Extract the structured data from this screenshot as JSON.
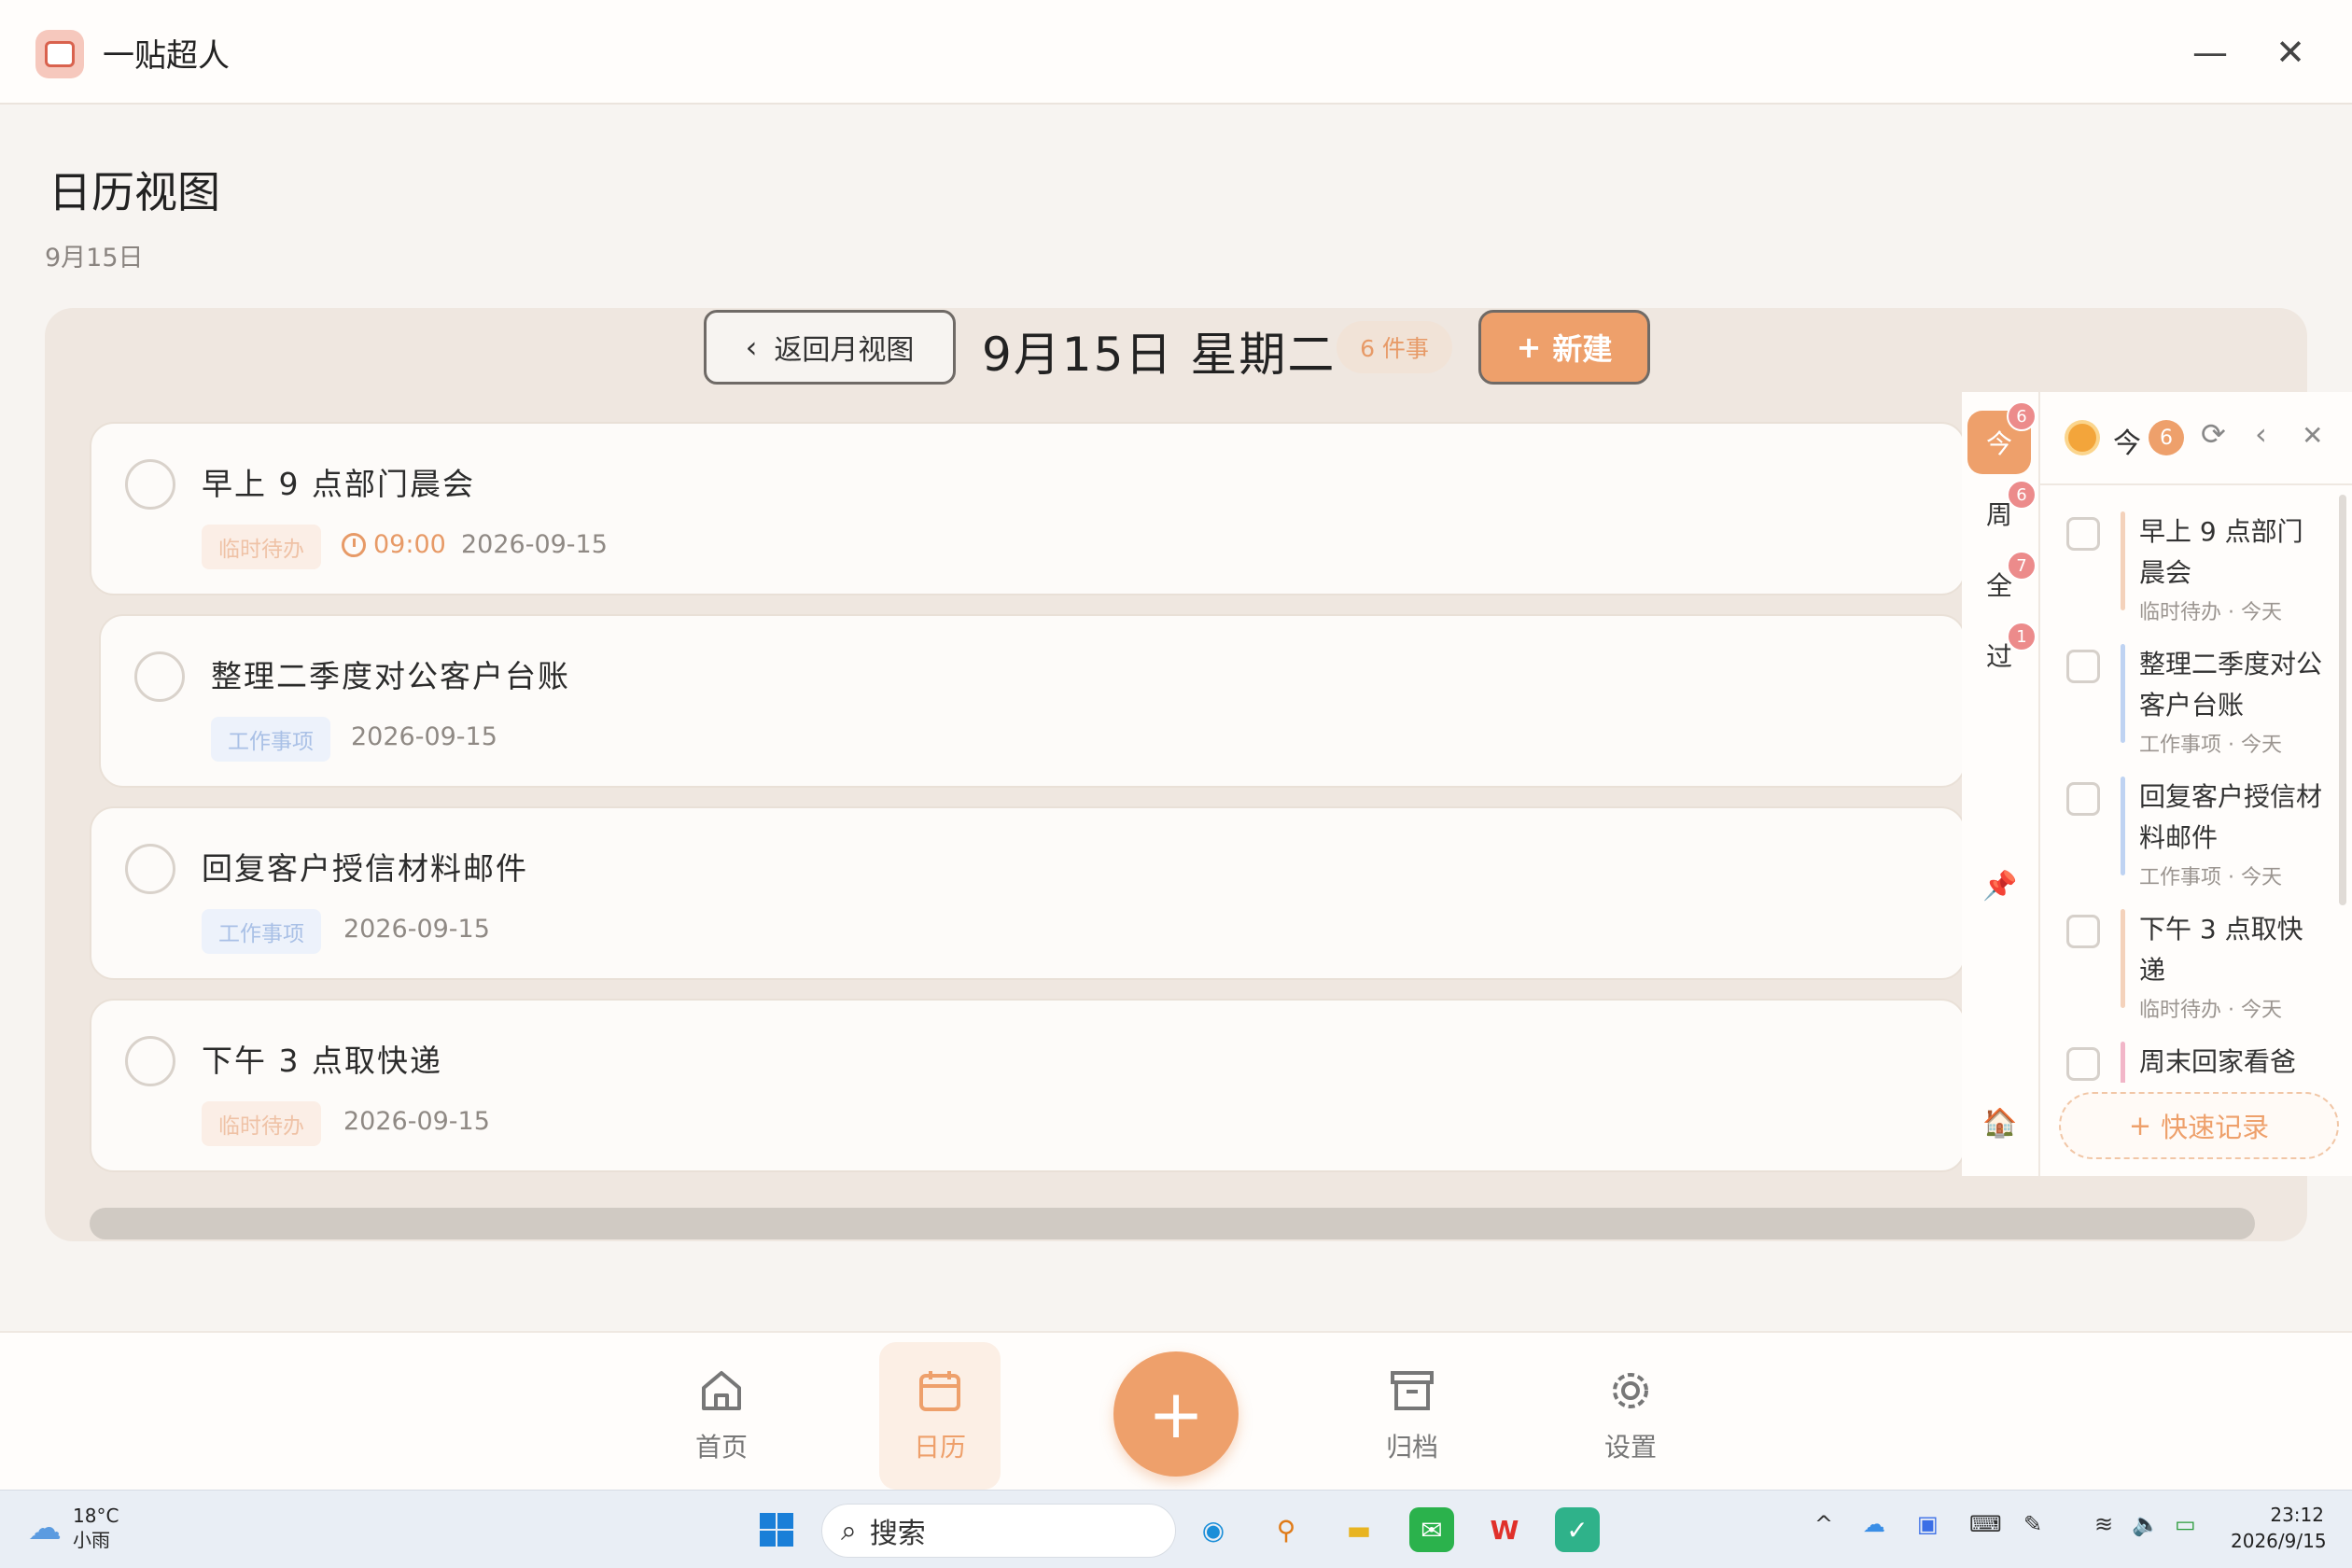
{
  "app": {
    "title": "一贴超人",
    "minimize": "—",
    "close": "✕"
  },
  "page": {
    "title": "日历视图",
    "subtitle": "9月15日"
  },
  "toolbar": {
    "back_label": "返回月视图",
    "date_heading": "9月15日 星期二",
    "count_label": "6 件事",
    "new_label": "新建"
  },
  "tasks": [
    {
      "title": "早上 9 点部门晨会",
      "tag": "临时待办",
      "time": "09:00",
      "date": "2026-09-15"
    },
    {
      "title": "整理二季度对公客户台账",
      "tag": "工作事项",
      "date": "2026-09-15"
    },
    {
      "title": "回复客户授信材料邮件",
      "tag": "工作事项",
      "date": "2026-09-15"
    },
    {
      "title": "下午 3 点取快递",
      "tag": "临时待办",
      "date": "2026-09-15"
    }
  ],
  "side_tabs": [
    {
      "label": "今",
      "badge": "6"
    },
    {
      "label": "周",
      "badge": "6"
    },
    {
      "label": "全",
      "badge": "7"
    },
    {
      "label": "过",
      "badge": "1"
    }
  ],
  "side_panel": {
    "today_label": "今",
    "today_count": "6",
    "items": [
      {
        "title": "早上 9 点部门晨会",
        "meta": "临时待办 · 今天",
        "bar_color": "#f4d2bb"
      },
      {
        "title": "整理二季度对公客户台账",
        "meta": "工作事项 · 今天",
        "bar_color": "#bfd3f2"
      },
      {
        "title": "回复客户授信材料邮件",
        "meta": "工作事项 · 今天",
        "bar_color": "#bfd3f2"
      },
      {
        "title": "下午 3 点取快递",
        "meta": "临时待办 · 今天",
        "bar_color": "#f4d2bb"
      },
      {
        "title": "周末回家看爸",
        "meta": "",
        "bar_color": "#f2b6c8"
      }
    ],
    "quick_label": "快速记录"
  },
  "nav": {
    "home": "首页",
    "calendar": "日历",
    "archive": "归档",
    "settings": "设置",
    "fab": "+"
  },
  "taskbar": {
    "temp": "18°C",
    "weather": "小雨",
    "search": "搜索",
    "time": "23:12",
    "date": "2026/9/15"
  }
}
